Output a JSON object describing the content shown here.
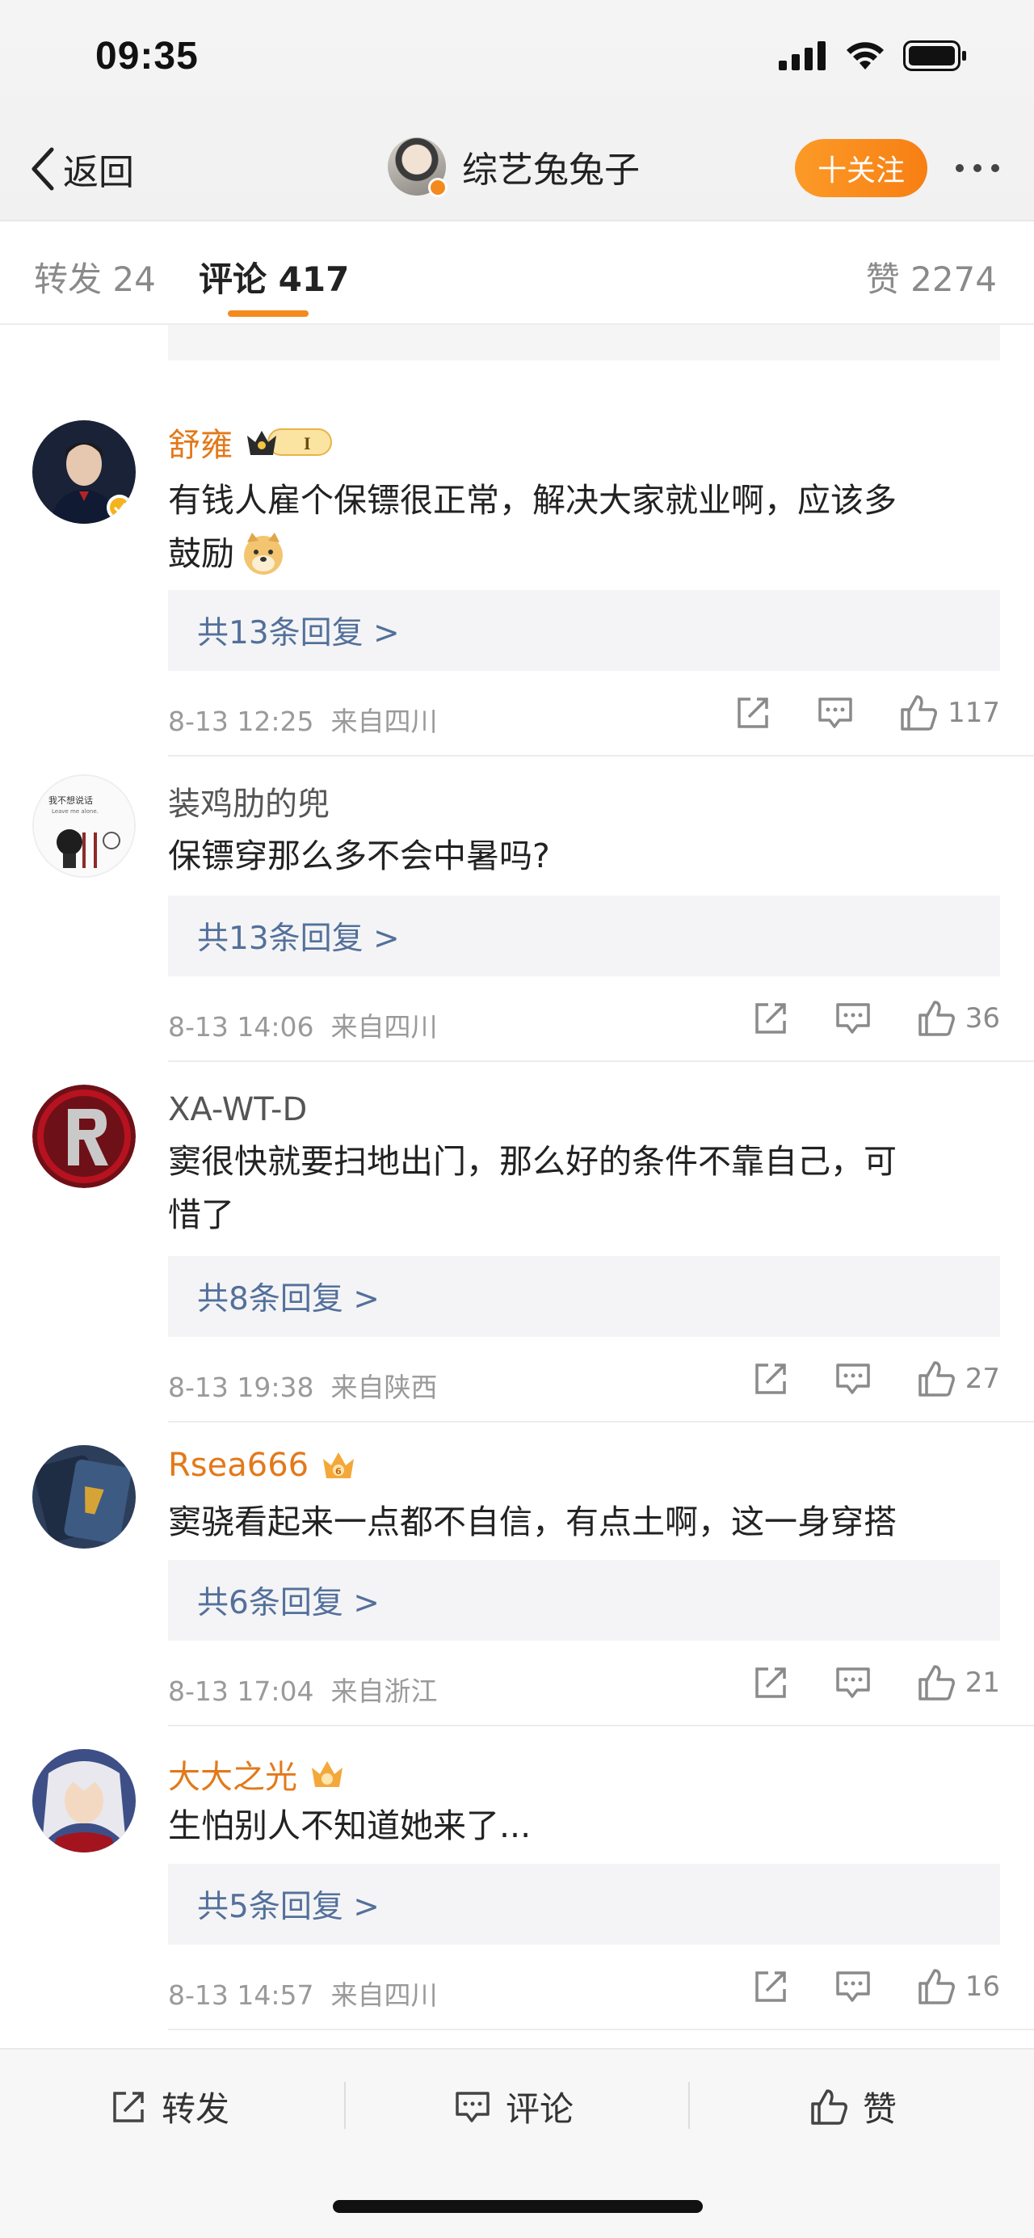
{
  "status": {
    "time": "09:35"
  },
  "nav": {
    "back_label": "返回",
    "profile_name": "综艺兔兔子",
    "follow_label": "十关注"
  },
  "tabs": {
    "repost": "转发 24",
    "comment": "评论 417",
    "like": "赞 2274"
  },
  "comments": [
    {
      "author": "舒雍",
      "author_color": "#e3791a",
      "badge": "crown-level-1",
      "text_lines": [
        "有钱人雇个保镖很正常，解决大家就业啊，应该多",
        "鼓励"
      ],
      "emoji": "doge-emoji",
      "replies": "共13条回复 >",
      "time": "8-13 12:25",
      "location": "来自四川",
      "likes": "117"
    },
    {
      "author": "装鸡肋的兜",
      "author_color": "#555555",
      "text_lines": [
        "保镖穿那么多不会中暑吗?"
      ],
      "replies": "共13条回复 >",
      "time": "8-13 14:06",
      "location": "来自四川",
      "likes": "36"
    },
    {
      "author": "XA-WT-D",
      "author_color": "#555555",
      "text_lines": [
        "窦很快就要扫地出门，那么好的条件不靠自己，可",
        "惜了"
      ],
      "replies": "共8条回复 >",
      "time": "8-13 19:38",
      "location": "来自陕西",
      "likes": "27"
    },
    {
      "author": "Rsea666",
      "author_color": "#e3791a",
      "badge": "crown-6",
      "text_lines": [
        "窦骁看起来一点都不自信，有点土啊，这一身穿搭"
      ],
      "replies": "共6条回复 >",
      "time": "8-13 17:04",
      "location": "来自浙江",
      "likes": "21"
    },
    {
      "author": "大大之光",
      "author_color": "#e3791a",
      "badge": "crown",
      "text_lines": [
        "生怕别人不知道她来了..."
      ],
      "replies": "共5条回复 >",
      "time": "8-13 14:57",
      "location": "来自四川",
      "likes": "16"
    }
  ],
  "bottom_bar": {
    "repost": "转发",
    "comment": "评论",
    "like": "赞"
  },
  "accent_color": "#f48a1e",
  "link_color": "#53709a"
}
